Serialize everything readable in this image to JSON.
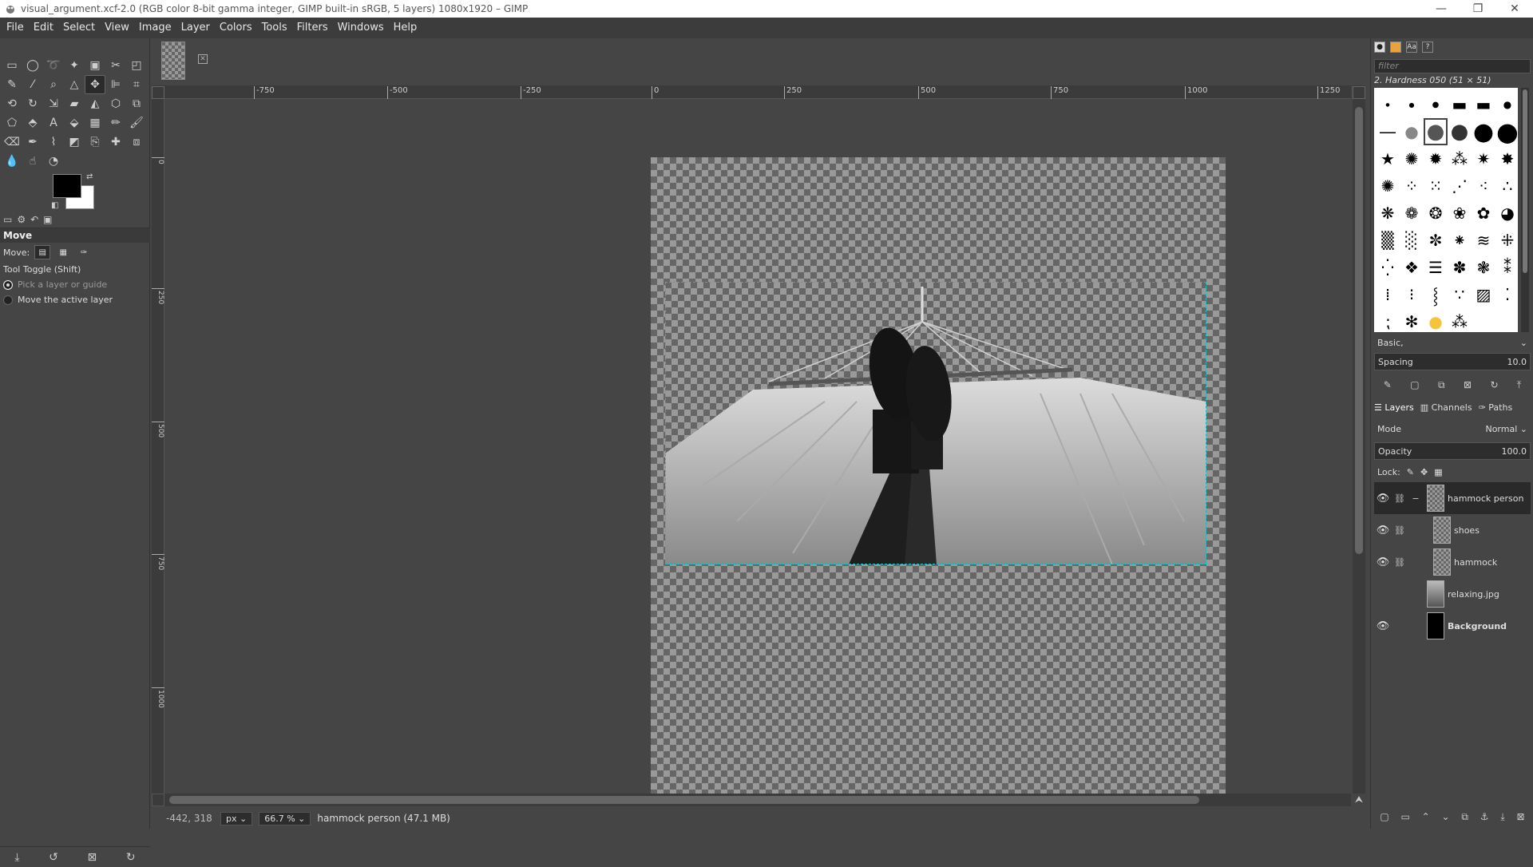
{
  "window": {
    "title": "visual_argument.xcf-2.0 (RGB color 8-bit gamma integer, GIMP built-in sRGB, 5 layers) 1080x1920 – GIMP",
    "minimize": "—",
    "maximize": "❐",
    "close": "✕"
  },
  "menu": [
    "File",
    "Edit",
    "Select",
    "View",
    "Image",
    "Layer",
    "Colors",
    "Tools",
    "Filters",
    "Windows",
    "Help"
  ],
  "tool_options": {
    "title": "Move",
    "move_label": "Move:",
    "toggle_label": "Tool Toggle  (Shift)",
    "option_pick": "Pick a layer or guide",
    "option_move": "Move the active layer"
  },
  "ruler_h_ticks": [
    "-750",
    "-500",
    "-250",
    "0",
    "250",
    "500",
    "750",
    "1000",
    "1250"
  ],
  "ruler_v_ticks": [
    "0",
    "250",
    "500",
    "750",
    "1000"
  ],
  "status": {
    "coords": "-442, 318",
    "unit": "px",
    "zoom": "66.7 %",
    "message": "hammock person (47.1 MB)"
  },
  "brushes": {
    "filter_placeholder": "filter",
    "selected_name": "2. Hardness 050 (51 × 51)",
    "preset": "Basic,",
    "spacing_label": "Spacing",
    "spacing_value": "10.0"
  },
  "layers_panel": {
    "tabs": [
      "Layers",
      "Channels",
      "Paths"
    ],
    "mode_label": "Mode",
    "mode_value": "Normal",
    "opacity_label": "Opacity",
    "opacity_value": "100.0",
    "lock_label": "Lock:",
    "layers": [
      {
        "name": "hammock person",
        "visible": true,
        "active": true,
        "bold": false
      },
      {
        "name": "shoes",
        "visible": true,
        "active": false,
        "bold": false
      },
      {
        "name": "hammock",
        "visible": true,
        "active": false,
        "bold": false
      },
      {
        "name": "relaxing.jpg",
        "visible": false,
        "active": false,
        "bold": false
      },
      {
        "name": "Background",
        "visible": true,
        "active": false,
        "bold": true
      }
    ]
  },
  "colors": {
    "foreground": "#000000",
    "background": "#ffffff",
    "selection": "#00c8c8"
  }
}
